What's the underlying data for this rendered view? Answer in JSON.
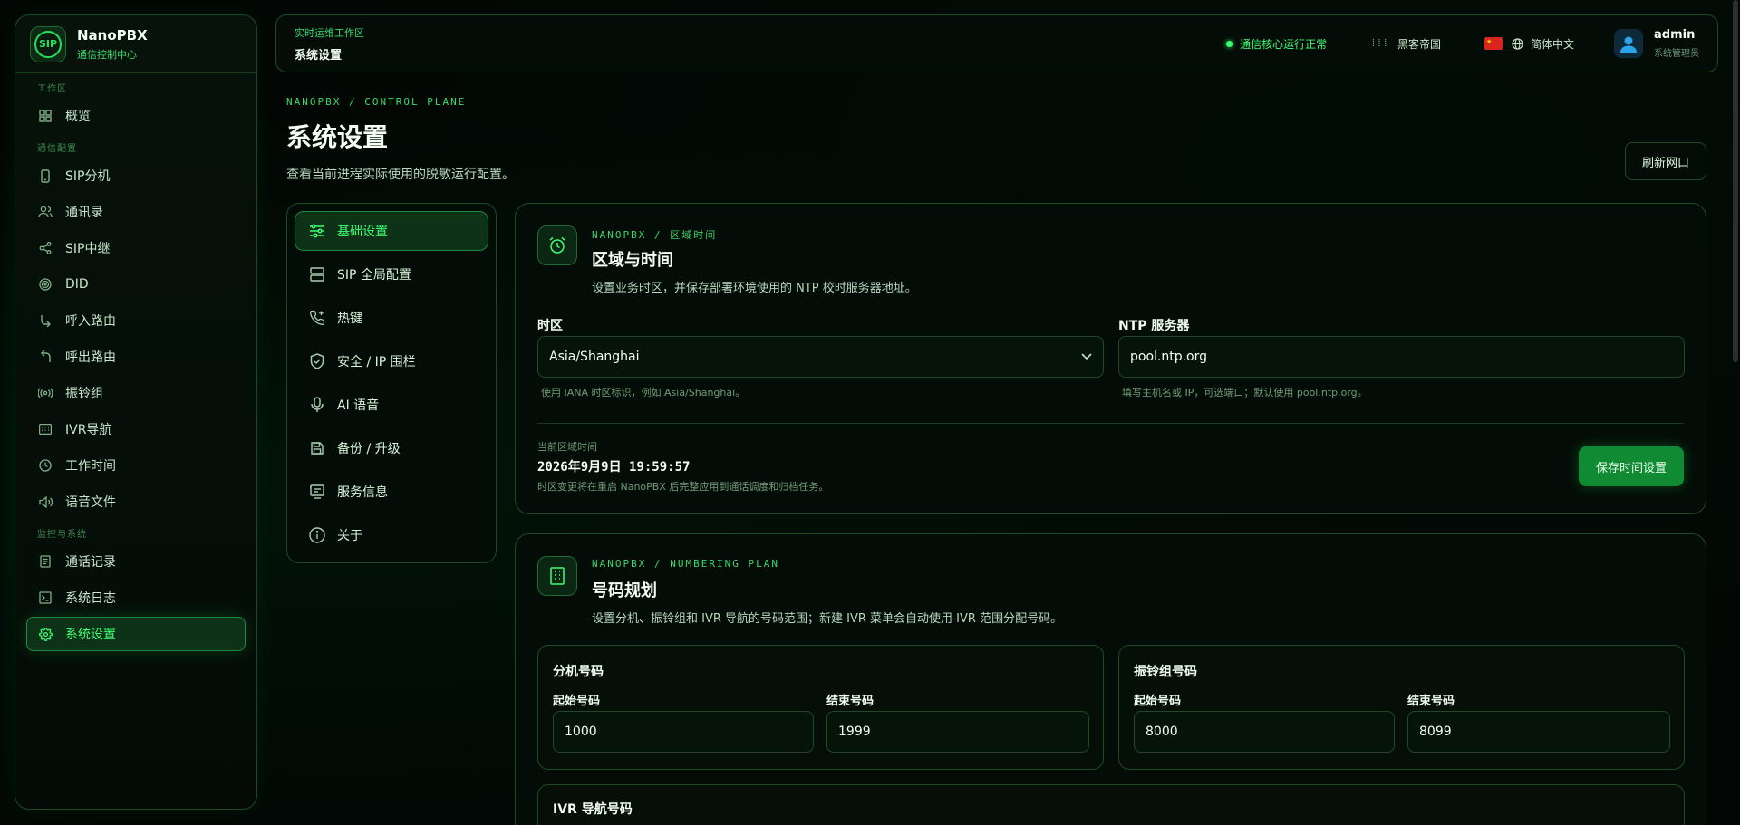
{
  "brand": {
    "logo_text": "SIP",
    "title": "NanoPBX",
    "subtitle": "通信控制中心"
  },
  "sidebar": {
    "sections": [
      {
        "label": "工作区"
      },
      {
        "label": "通信配置"
      },
      {
        "label": "监控与系统"
      }
    ],
    "items": [
      {
        "label": "概览",
        "icon": "grid-icon"
      },
      {
        "label": "SIP分机",
        "icon": "phone-icon"
      },
      {
        "label": "通讯录",
        "icon": "users-icon"
      },
      {
        "label": "SIP中继",
        "icon": "share-icon"
      },
      {
        "label": "DID",
        "icon": "target-icon"
      },
      {
        "label": "呼入路由",
        "icon": "arrow-in-icon"
      },
      {
        "label": "呼出路由",
        "icon": "arrow-out-icon"
      },
      {
        "label": "振铃组",
        "icon": "radio-icon"
      },
      {
        "label": "IVR导航",
        "icon": "keypad-icon"
      },
      {
        "label": "工作时间",
        "icon": "clock-icon"
      },
      {
        "label": "语音文件",
        "icon": "speaker-icon"
      },
      {
        "label": "通话记录",
        "icon": "file-icon"
      },
      {
        "label": "系统日志",
        "icon": "terminal-icon"
      },
      {
        "label": "系统设置",
        "icon": "gear-icon"
      }
    ]
  },
  "topbar": {
    "crumb_small": "实时运维工作区",
    "crumb_main": "系统设置",
    "status": "通信核心运行正常",
    "theme": "黑客帝国",
    "language": "简体中文",
    "user_name": "admin",
    "user_role": "系统管理员"
  },
  "page": {
    "eyebrow": "NANOPBX / CONTROL PLANE",
    "title": "系统设置",
    "description": "查看当前进程实际使用的脱敏运行配置。",
    "refresh_label": "刷新网口"
  },
  "tabs": [
    {
      "label": "基础设置",
      "icon": "sliders-icon"
    },
    {
      "label": "SIP 全局配置",
      "icon": "server-icon"
    },
    {
      "label": "热键",
      "icon": "phone-plus-icon"
    },
    {
      "label": "安全 / IP 围栏",
      "icon": "shield-icon"
    },
    {
      "label": "AI 语音",
      "icon": "mic-icon"
    },
    {
      "label": "备份 / 升级",
      "icon": "save-icon"
    },
    {
      "label": "服务信息",
      "icon": "monitor-icon"
    },
    {
      "label": "关于",
      "icon": "info-icon"
    }
  ],
  "timezone_card": {
    "eyebrow": "NANOPBX / 区域时间",
    "title": "区域与时间",
    "description": "设置业务时区，并保存部署环境使用的 NTP 校时服务器地址。",
    "tz_label": "时区",
    "tz_value": "Asia/Shanghai",
    "tz_help": "使用 IANA 时区标识，例如 Asia/Shanghai。",
    "ntp_label": "NTP 服务器",
    "ntp_value": "pool.ntp.org",
    "ntp_help": "填写主机名或 IP，可选端口；默认使用 pool.ntp.org。",
    "current_label": "当前区域时间",
    "current_value": "2026年9月9日 19:59:57",
    "current_note": "时区变更将在重启 NanoPBX 后完整应用到通话调度和归档任务。",
    "save_label": "保存时间设置"
  },
  "numbering_card": {
    "eyebrow": "NANOPBX / NUMBERING PLAN",
    "title": "号码规划",
    "description": "设置分机、振铃组和 IVR 导航的号码范围；新建 IVR 菜单会自动使用 IVR 范围分配号码。",
    "ext": {
      "title": "分机号码",
      "start_label": "起始号码",
      "start_value": "1000",
      "end_label": "结束号码",
      "end_value": "1999"
    },
    "ring": {
      "title": "振铃组号码",
      "start_label": "起始号码",
      "start_value": "8000",
      "end_label": "结束号码",
      "end_value": "8099"
    },
    "ivr": {
      "title": "IVR 导航号码"
    }
  }
}
